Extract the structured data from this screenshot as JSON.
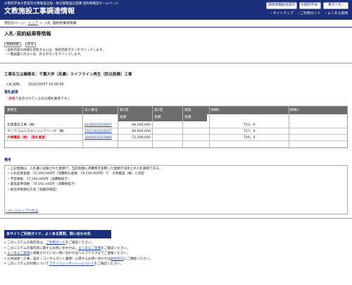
{
  "header": {
    "subtitle": "文部科学省大臣官房文教施設企画・防災部施設企画課 契約情報室ホームページ",
    "title": "文教施設工事調達情報",
    "buttons": [
      "調達情報総合案内",
      "文部科学省",
      "電子入札"
    ],
    "links": [
      "サイトマップ",
      "ご利用ガイド",
      "よくある質問"
    ]
  },
  "breadcrumb": {
    "prefix": "現在のページ：",
    "top": "トップ",
    "sep": "＞",
    "current": "入札･契約結果等情報"
  },
  "page": {
    "title": "入札･契約結果等情報",
    "buttons": [
      "契約内容",
      "戻る"
    ],
    "notes": [
      "・契約内容の詳細を参照するには、契約内容ボタンをクリックします。",
      "・一覧画面に戻るには、戻るボタンをクリックします。"
    ]
  },
  "project": {
    "title": "工事名又は業務名：千葉大学（亥鼻）ライフライン再生（防災設備）工事",
    "date_label": "入札日時：",
    "date_value": "2020/10/07 10:00:00"
  },
  "results": {
    "section": "落札結果",
    "note_prefix": "（",
    "note_red": "赤色",
    "note_suffix": "で表示されているのは落札業者です。）",
    "headers": {
      "name": "業者名",
      "corp": "法人番号",
      "round1": "第1回",
      "round2": "第2回",
      "consult": "随契",
      "remark1": "摘要1",
      "remark2": "摘要2",
      "amount": "金額"
    },
    "rows": [
      {
        "name": "北陸電気工事（株）",
        "corp": "6230001003007",
        "amount": "88,000,000",
        "remark1": "T23，9",
        "winner": false
      },
      {
        "name": "サンワコムシスエンジニアリング（株）",
        "corp": "7011301014037",
        "amount": "89,900,000",
        "remark1": "T27，9",
        "winner": false
      },
      {
        "name": "大崎電設（株）（落札業者）",
        "corp": "3040001053868",
        "amount": "72,309,000",
        "remark1": "T49，4",
        "winner": true
      }
    ]
  },
  "remarks": {
    "section": "備考",
    "lines": [
      "・上記金額は，入札書に記載された金額で，当該金額に消費税を加算した金額が法律上の入札価格である。",
      "・入札結果金額　72,309,000円（消費税込金額　79,539,900円）で　大崎電設（株）に決定",
      "・予定価格　77,290,000円（消費税抜き）",
      "・最低基準価格　70,192,445円（消費税抜き）",
      "・総合評価落札方式［実績評価型］"
    ]
  },
  "pagetop": "ページトップへ戻る",
  "guide": {
    "title": "本サイトご利用ガイド、よくある質問、問い合わせ先",
    "items": [
      [
        "このシステムの操作等は，",
        "ご利用ガイド",
        "をご確認ください。"
      ],
      [
        "このシステムの操作等に関するお問い合わせは，",
        "よくあるご質問",
        "をご確認ください。"
      ],
      [
        "",
        "よくあるご質問",
        "に掲載されていない問い合わせはヘルプデスクまでご連絡ください。"
      ],
      [
        "公共調達（工事，設計・コンサルタント業務）に関するお問い合わせは",
        "総合窓口",
        "にご連絡ください。"
      ],
      [
        "このシステムの利用について",
        "プライバシーポリシーについて",
        "をご確認ください。"
      ]
    ]
  }
}
